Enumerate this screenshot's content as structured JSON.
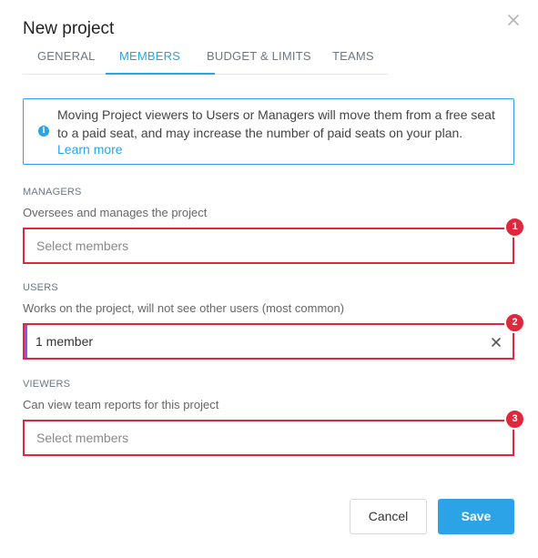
{
  "dialog": {
    "title": "New project",
    "close_icon": "close-icon"
  },
  "tabs": [
    {
      "label": "GENERAL",
      "active": false
    },
    {
      "label": "MEMBERS",
      "active": true
    },
    {
      "label": "BUDGET & LIMITS",
      "active": false
    },
    {
      "label": "TEAMS",
      "active": false
    }
  ],
  "info_banner": {
    "icon": "info-icon",
    "text": "Moving Project viewers to Users or Managers will move them from a free seat to a paid seat, and may increase the number of paid seats on your plan.",
    "link": "Learn more"
  },
  "managers": {
    "label": "MANAGERS",
    "description": "Oversees and manages the project",
    "placeholder": "Select members",
    "badge": "1"
  },
  "users": {
    "label": "USERS",
    "description": "Works on the project, will not see other users (most common)",
    "value": "1 member",
    "badge": "2"
  },
  "viewers": {
    "label": "VIEWERS",
    "description": "Can view team reports for this project",
    "placeholder": "Select members",
    "badge": "3"
  },
  "footer": {
    "cancel_label": "Cancel",
    "save_label": "Save"
  },
  "colors": {
    "accent": "#2ba3e6",
    "error": "#e0283c",
    "selected_bar": "#7b5cf5"
  }
}
